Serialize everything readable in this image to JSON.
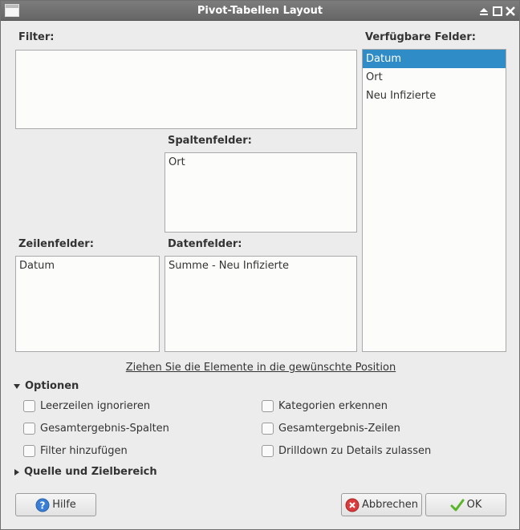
{
  "window": {
    "title": "Pivot-Tabellen Layout"
  },
  "labels": {
    "filter": "Filter:",
    "available_fields": "Verfügbare Felder:",
    "column_fields": "Spaltenfelder:",
    "row_fields": "Zeilenfelder:",
    "data_fields": "Datenfelder:"
  },
  "available_fields": {
    "items": [
      "Datum",
      "Ort",
      "Neu Infizierte"
    ],
    "selected": "Datum"
  },
  "column_fields": {
    "items": [
      "Ort"
    ]
  },
  "row_fields": {
    "items": [
      "Datum"
    ]
  },
  "data_fields": {
    "items": [
      "Summe - Neu Infizierte"
    ]
  },
  "hint": "Ziehen Sie die Elemente in die gewünschte Position",
  "options": {
    "header": "Optionen",
    "ignore_empty_rows": "Leerzeilen ignorieren",
    "identify_categories": "Kategorien erkennen",
    "total_columns": "Gesamtergebnis-Spalten",
    "total_rows": "Gesamtergebnis-Zeilen",
    "add_filter": "Filter hinzufügen",
    "enable_drilldown": "Drilldown zu Details zulassen"
  },
  "source_section": {
    "header": "Quelle und Zielbereich"
  },
  "buttons": {
    "help": "Hilfe",
    "cancel": "Abbrechen",
    "ok": "OK"
  },
  "colors": {
    "selection": "#308cc6",
    "titlebar": "#707070"
  },
  "icons": [
    "window-menu-icon",
    "eject-icon",
    "maximize-icon",
    "close-icon",
    "help-icon",
    "cancel-icon",
    "checkmark-icon",
    "chevron-down-icon",
    "chevron-right-icon"
  ]
}
